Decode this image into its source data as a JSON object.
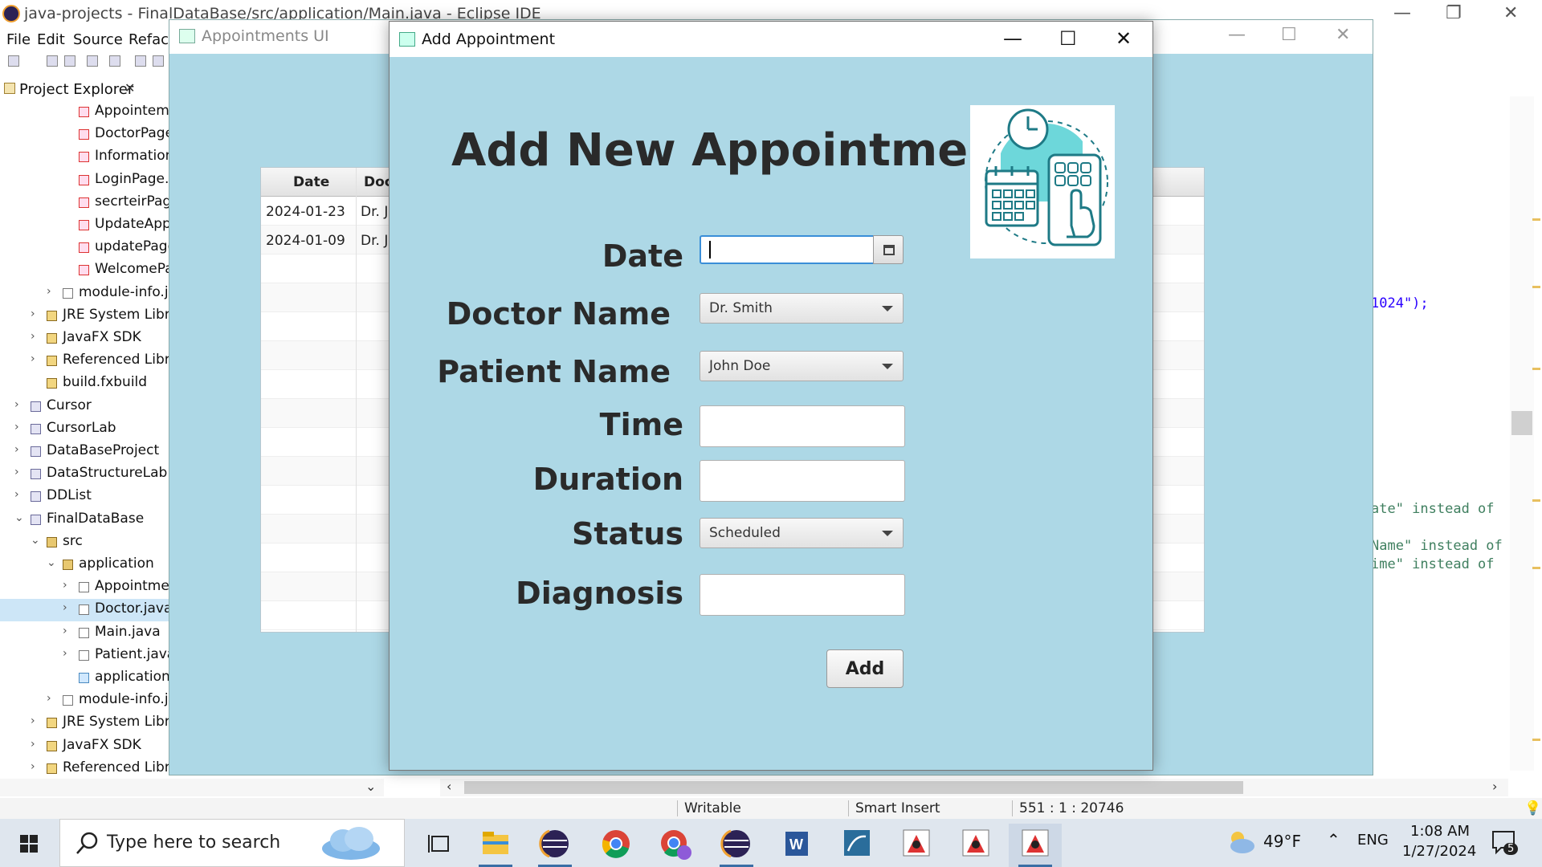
{
  "eclipse": {
    "title": "java-projects - FinalDataBase/src/application/Main.java - Eclipse IDE",
    "menu": [
      "File",
      "Edit",
      "Source",
      "Refacto"
    ],
    "project_explorer_label": "Project Explorer",
    "tree": [
      {
        "label": "Appointem",
        "indent": 98,
        "icon": "err"
      },
      {
        "label": "DoctorPage",
        "indent": 98,
        "icon": "err"
      },
      {
        "label": "Information",
        "indent": 98,
        "icon": "err"
      },
      {
        "label": "LoginPage.f",
        "indent": 98,
        "icon": "err"
      },
      {
        "label": "secrteirPage",
        "indent": 98,
        "icon": "err"
      },
      {
        "label": "UpdateApp",
        "indent": 98,
        "icon": "err"
      },
      {
        "label": "updatePage",
        "indent": 98,
        "icon": "err"
      },
      {
        "label": "WelcomePa",
        "indent": 98,
        "icon": "err"
      },
      {
        "label": "module-info.ja",
        "indent": 78,
        "icon": "jv",
        "arrow": true
      },
      {
        "label": "JRE System Librar",
        "indent": 58,
        "icon": "jar",
        "arrow": true
      },
      {
        "label": "JavaFX SDK",
        "indent": 58,
        "icon": "jar",
        "arrow": true
      },
      {
        "label": "Referenced Librar",
        "indent": 58,
        "icon": "jar",
        "arrow": true
      },
      {
        "label": "build.fxbuild",
        "indent": 58,
        "icon": "jar"
      },
      {
        "label": "Cursor",
        "indent": 38,
        "icon": "prj",
        "arrow": true
      },
      {
        "label": "CursorLab",
        "indent": 38,
        "icon": "prj",
        "arrow": true
      },
      {
        "label": "DataBaseProject",
        "indent": 38,
        "icon": "prj",
        "arrow": true
      },
      {
        "label": "DataStructureLab",
        "indent": 38,
        "icon": "prj",
        "arrow": true
      },
      {
        "label": "DDList",
        "indent": 38,
        "icon": "prj",
        "arrow": true
      },
      {
        "label": "FinalDataBase",
        "indent": 38,
        "icon": "prj",
        "arrow": true,
        "open": true
      },
      {
        "label": "src",
        "indent": 58,
        "icon": "pkg",
        "arrow": true,
        "open": true
      },
      {
        "label": "application",
        "indent": 78,
        "icon": "pkg",
        "arrow": true,
        "open": true
      },
      {
        "label": "Appointme",
        "indent": 98,
        "icon": "jv",
        "arrow": true
      },
      {
        "label": "Doctor.java",
        "indent": 98,
        "icon": "jv",
        "arrow": true,
        "selected": true
      },
      {
        "label": "Main.java",
        "indent": 98,
        "icon": "jv",
        "arrow": true
      },
      {
        "label": "Patient.java",
        "indent": 98,
        "icon": "jv",
        "arrow": true
      },
      {
        "label": "application.",
        "indent": 98,
        "icon": "css"
      },
      {
        "label": "module-info.ja",
        "indent": 78,
        "icon": "jv",
        "arrow": true
      },
      {
        "label": "JRE System Librar",
        "indent": 58,
        "icon": "jar",
        "arrow": true
      },
      {
        "label": "JavaFX SDK",
        "indent": 58,
        "icon": "jar",
        "arrow": true
      },
      {
        "label": "Referenced Librar",
        "indent": 58,
        "icon": "jar",
        "arrow": true
      },
      {
        "label": "build.fxbuild",
        "indent": 58,
        "icon": "jar"
      }
    ],
    "code": {
      "line1": "1024\");",
      "line2": "ate\" instead of",
      "line3": "Name\" instead of",
      "line4": "ime\" instead of"
    },
    "status": {
      "writable": "Writable",
      "insert_mode": "Smart Insert",
      "position": "551 : 1 : 20746"
    }
  },
  "appointments_window": {
    "title": "Appointments UI",
    "table": {
      "headers": [
        "Date",
        "Doc"
      ],
      "rows": [
        [
          "2024-01-23",
          "Dr. Jo"
        ],
        [
          "2024-01-09",
          "Dr. Jo"
        ]
      ]
    }
  },
  "dialog": {
    "title": "Add Appointment",
    "heading": "Add New Appointment",
    "labels": {
      "date": "Date",
      "doctor": "Doctor Name",
      "patient": "Patient Name",
      "time": "Time",
      "duration": "Duration",
      "status": "Status",
      "diagnosis": "Diagnosis"
    },
    "values": {
      "date": "",
      "doctor": "Dr. Smith",
      "patient": "John Doe",
      "time": "",
      "duration": "",
      "status": "Scheduled",
      "diagnosis": ""
    },
    "add_button": "Add"
  },
  "taskbar": {
    "search_placeholder": "Type here to search",
    "weather": "49°F",
    "language": "ENG",
    "time": "1:08 AM",
    "date": "1/27/2024",
    "notification_count": "5"
  },
  "colors": {
    "dialog_bg": "#add8e6",
    "focus_border": "#3a8ed8",
    "illustration_teal": "#4fc3c7"
  }
}
